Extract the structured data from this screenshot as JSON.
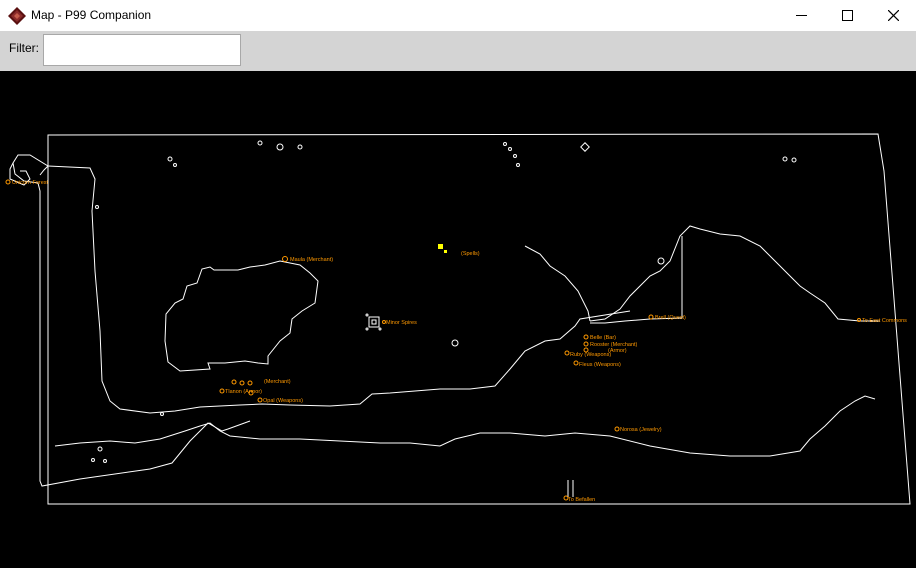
{
  "window": {
    "title": "Map - P99 Companion",
    "icon": "app-diamond-icon",
    "controls": [
      "minimize-icon",
      "maximize-icon",
      "close-icon"
    ]
  },
  "toolbar": {
    "filter_label": "Filter:",
    "filter_value": ""
  },
  "colors": {
    "map_background": "#000000",
    "map_lines": "#ffffff",
    "poi_label": "#ff9900",
    "poi_marker_yellow": "#ffff00"
  },
  "map": {
    "labels": {
      "poi_zone_west": "Unicorn Forest",
      "poi_maula": "Maula (Merchant)",
      "poi_spells": "(Spells)",
      "poi_minor_spires": "Minor Spires",
      "poi_quest_mid": "Brell (Quest)",
      "poi_zone_east": "To East Commons",
      "poi_belle": "Belle (Bar)",
      "poi_rooster": "Rooster (Merchant)",
      "poi_armor_e": "(Armor)",
      "poi_ruby": "Ruby (Weapons)",
      "poi_fleus": "Fleus (Weapons)",
      "poi_mesh_w": "(Merchant)",
      "poi_tlanon": "Tlanon (Armor)",
      "poi_opal": "Opal (Weapons)",
      "poi_norosa": "Norosa (Jewelry)",
      "poi_zone_south": "To Befallen"
    }
  }
}
